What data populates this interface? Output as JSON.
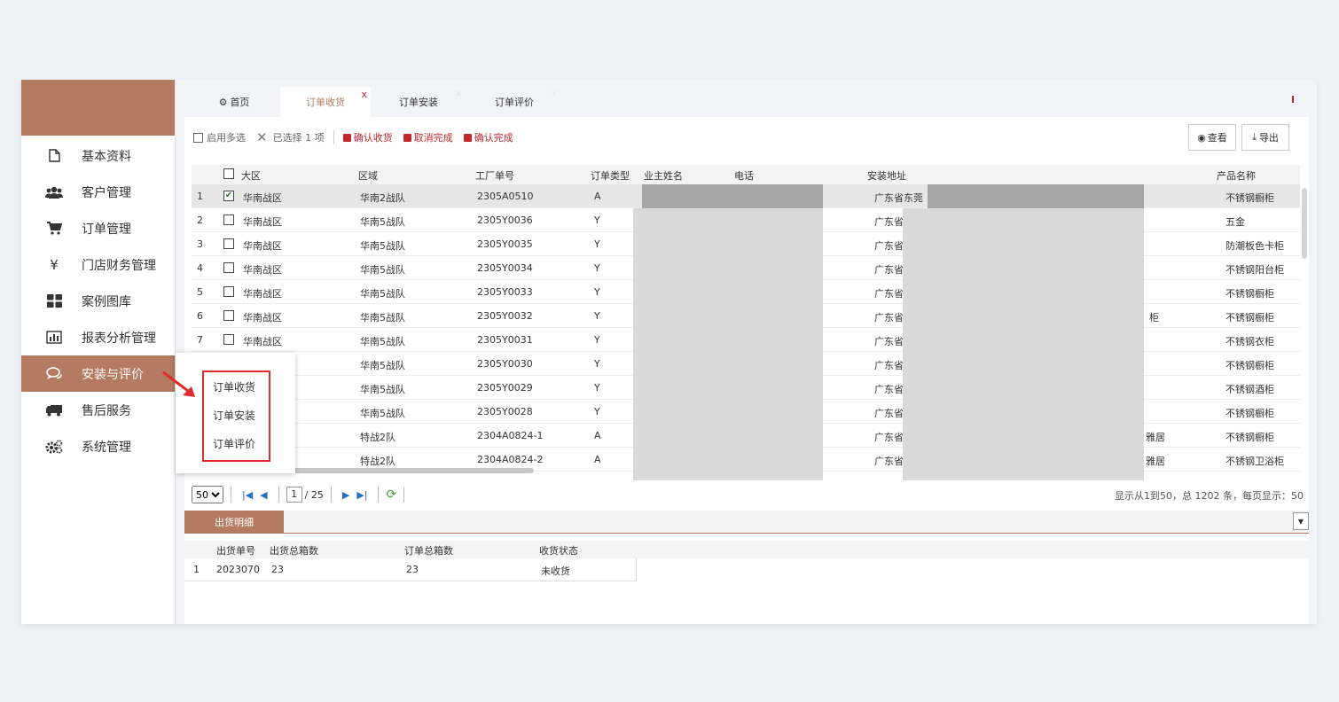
{
  "sidebar": {
    "items": [
      {
        "label": "基本资料",
        "icon": "file-icon"
      },
      {
        "label": "客户管理",
        "icon": "users-icon"
      },
      {
        "label": "订单管理",
        "icon": "cart-icon"
      },
      {
        "label": "门店财务管理",
        "icon": "yen-icon"
      },
      {
        "label": "案例图库",
        "icon": "grid-icon"
      },
      {
        "label": "报表分析管理",
        "icon": "bar-chart-icon"
      },
      {
        "label": "安装与评价",
        "icon": "chat-icon",
        "active": true
      },
      {
        "label": "售后服务",
        "icon": "truck-icon"
      },
      {
        "label": "系统管理",
        "icon": "gears-icon"
      }
    ]
  },
  "popup": {
    "items": [
      "订单收货",
      "订单安装",
      "订单评价"
    ]
  },
  "tabs": [
    {
      "label": "首页",
      "icon": "gears-icon"
    },
    {
      "label": "订单收货",
      "close": "x",
      "active": true
    },
    {
      "label": "订单安装",
      "close": "x"
    },
    {
      "label": "订单评价",
      "close": "x"
    }
  ],
  "toolbar": {
    "multi_select": "启用多选",
    "selected": "已选择 1 项",
    "confirm_receive": "确认收货",
    "cancel_complete": "取消完成",
    "confirm_complete": "确认完成",
    "view": "查看",
    "export": "导出"
  },
  "grid": {
    "columns": [
      "大区",
      "区域",
      "工厂单号",
      "订单类型",
      "业主姓名",
      "电话",
      "安装地址",
      "产品名称"
    ],
    "rows": [
      {
        "no": "1",
        "checked": true,
        "region": "华南战区",
        "area": "华南2战队",
        "order": "2305A0510",
        "type": "A",
        "addr": "广东省东莞",
        "addr_tail": "",
        "product": "不锈钢橱柜"
      },
      {
        "no": "2",
        "checked": false,
        "region": "华南战区",
        "area": "华南5战队",
        "order": "2305Y0036",
        "type": "Y",
        "addr": "广东省",
        "addr_tail": "",
        "product": "五金"
      },
      {
        "no": "3",
        "checked": false,
        "region": "华南战区",
        "area": "华南5战队",
        "order": "2305Y0035",
        "type": "Y",
        "addr": "广东省",
        "addr_tail": "",
        "product": "防潮板色卡柜"
      },
      {
        "no": "4",
        "checked": false,
        "region": "华南战区",
        "area": "华南5战队",
        "order": "2305Y0034",
        "type": "Y",
        "addr": "广东省",
        "addr_tail": "",
        "product": "不锈钢阳台柜"
      },
      {
        "no": "5",
        "checked": false,
        "region": "华南战区",
        "area": "华南5战队",
        "order": "2305Y0033",
        "type": "Y",
        "addr": "广东省",
        "addr_tail": "",
        "product": "不锈钢橱柜"
      },
      {
        "no": "6",
        "checked": false,
        "region": "华南战区",
        "area": "华南5战队",
        "order": "2305Y0032",
        "type": "Y",
        "addr": "广东省",
        "addr_tail": "柜",
        "product": "不锈钢橱柜"
      },
      {
        "no": "7",
        "checked": false,
        "region": "华南战区",
        "area": "华南5战队",
        "order": "2305Y0031",
        "type": "Y",
        "addr": "广东省",
        "addr_tail": "",
        "product": "不锈钢衣柜"
      },
      {
        "no": "",
        "checked": null,
        "region": "",
        "area": "华南5战队",
        "order": "2305Y0030",
        "type": "Y",
        "addr": "广东省",
        "addr_tail": "",
        "product": "不锈钢橱柜"
      },
      {
        "no": "",
        "checked": null,
        "region": "",
        "area": "华南5战队",
        "order": "2305Y0029",
        "type": "Y",
        "addr": "广东省",
        "addr_tail": "",
        "product": "不锈钢酒柜"
      },
      {
        "no": "",
        "checked": null,
        "region": "",
        "area": "华南5战队",
        "order": "2305Y0028",
        "type": "Y",
        "addr": "广东省",
        "addr_tail": "",
        "product": "不锈钢橱柜"
      },
      {
        "no": "",
        "checked": null,
        "region": "",
        "area": "特战2队",
        "order": "2304A0824-1",
        "type": "A",
        "addr": "广东省",
        "addr_tail": "雅居",
        "product": "不锈钢橱柜"
      },
      {
        "no": "",
        "checked": null,
        "region": "",
        "area": "特战2队",
        "order": "2304A0824-2",
        "type": "A",
        "addr": "广东省",
        "addr_tail": "雅居",
        "product": "不锈钢卫浴柜"
      }
    ]
  },
  "pager": {
    "page_size": "50",
    "current": "1",
    "total_pages": "/ 25",
    "info": "显示从1到50，总 1202 条，每页显示：50"
  },
  "detail": {
    "tab": "出货明细",
    "columns": [
      "出货单号",
      "出货总箱数",
      "订单总箱数",
      "收货状态"
    ],
    "rows": [
      {
        "no": "1",
        "ship": "2023070",
        "ship_total": "23",
        "order_total": "23",
        "status": "未收货"
      }
    ]
  },
  "colors": {
    "brand": "#b57b62",
    "accent_red": "#c0282d",
    "highlight_box": "#e02b2b"
  }
}
